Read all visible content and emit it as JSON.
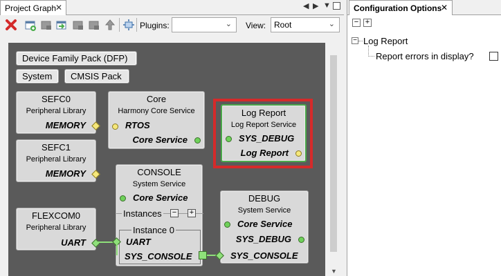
{
  "left_panel": {
    "tab_label": "Project Graph",
    "tab_close": "✕",
    "toolbar": {
      "plugins_label": "Plugins:",
      "plugins_value": "",
      "view_label": "View:",
      "view_value": "Root"
    },
    "chips": {
      "dfp": "Device Family Pack (DFP)",
      "system": "System",
      "cmsis": "CMSIS Pack"
    },
    "nodes": {
      "sefc0": {
        "title": "SEFC0",
        "subtitle": "Peripheral Library",
        "port": "MEMORY"
      },
      "sefc1": {
        "title": "SEFC1",
        "subtitle": "Peripheral Library",
        "port": "MEMORY"
      },
      "flexcom0": {
        "title": "FLEXCOM0",
        "subtitle": "Peripheral Library",
        "port": "UART"
      },
      "core": {
        "title": "Core",
        "subtitle": "Harmony Core Service",
        "port1": "RTOS",
        "port2": "Core Service"
      },
      "log_report": {
        "title": "Log Report",
        "subtitle": "Log Report Service",
        "port1": "SYS_DEBUG",
        "port2": "Log Report"
      },
      "console": {
        "title": "CONSOLE",
        "subtitle": "System Service",
        "port1": "Core Service",
        "instances_label": "Instances",
        "instance_title": "Instance 0",
        "port2": "UART",
        "port3": "SYS_CONSOLE"
      },
      "debug": {
        "title": "DEBUG",
        "subtitle": "System Service",
        "port1": "Core Service",
        "port2": "SYS_DEBUG",
        "port3": "SYS_CONSOLE"
      }
    }
  },
  "right_panel": {
    "tab_label": "Configuration Options",
    "tab_close": "✕",
    "tree": {
      "root_label": "Log Report",
      "child_label": "Report errors in display?",
      "child_checked": false
    }
  },
  "colors": {
    "canvas": "#5a5a5a",
    "selection": "#d52a2a",
    "port_green": "#6fd15a",
    "port_yellow": "#f5e77a"
  }
}
